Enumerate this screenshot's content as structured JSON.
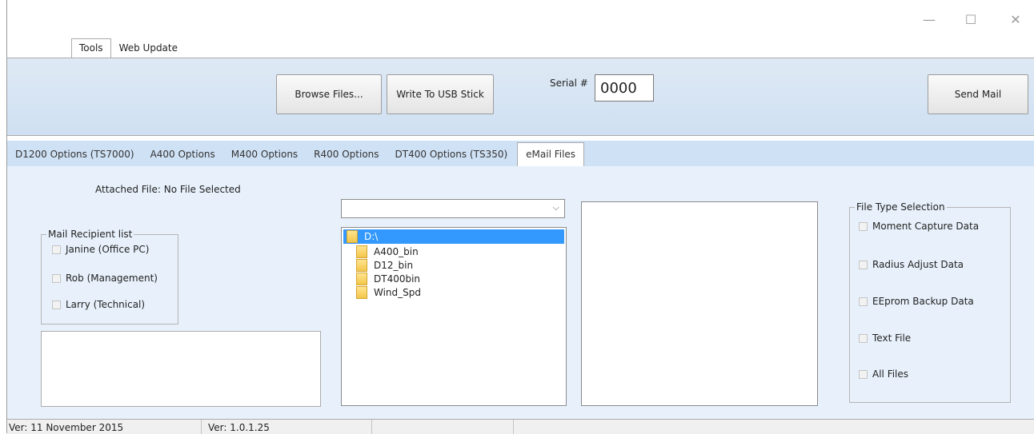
{
  "window_controls": {
    "minimize": "—",
    "maximize": "☐",
    "close": "✕"
  },
  "top_tabs": [
    {
      "label": "Tools",
      "active": true
    },
    {
      "label": "Web Update",
      "active": false
    }
  ],
  "toolbar": {
    "browse_label": "Browse Files...",
    "write_usb_label": "Write To USB Stick",
    "serial_label": "Serial #",
    "serial_value": "0000",
    "send_mail_label": "Send Mail"
  },
  "sub_tabs": [
    {
      "label": "D1200 Options (TS7000)",
      "active": false
    },
    {
      "label": "A400 Options",
      "active": false
    },
    {
      "label": "M400 Options",
      "active": false
    },
    {
      "label": "R400 Options",
      "active": false
    },
    {
      "label": "DT400 Options (TS350)",
      "active": false
    },
    {
      "label": "eMail Files",
      "active": true
    }
  ],
  "email": {
    "attached_file": "Attached File: No File Selected",
    "recipients": {
      "legend": "Mail Recipient list",
      "items": [
        {
          "label": "Janine (Office PC)",
          "checked": false
        },
        {
          "label": "Rob (Management)",
          "checked": false
        },
        {
          "label": "Larry (Technical)",
          "checked": false
        }
      ]
    },
    "drive_combo_value": "",
    "directories": [
      {
        "label": "D:\\",
        "selected": true
      },
      {
        "label": "A400_bin",
        "selected": false
      },
      {
        "label": "D12_bin",
        "selected": false
      },
      {
        "label": "DT400bin",
        "selected": false
      },
      {
        "label": "Wind_Spd",
        "selected": false
      }
    ],
    "file_types": {
      "legend": "File Type Selection",
      "items": [
        {
          "label": "Moment Capture Data",
          "checked": false
        },
        {
          "label": "Radius Adjust Data",
          "checked": false
        },
        {
          "label": "EEprom Backup Data",
          "checked": false
        },
        {
          "label": "Text File",
          "checked": false
        },
        {
          "label": "All Files",
          "checked": false
        }
      ]
    }
  },
  "status_bar": {
    "date_version": "Ver: 11 November 2015",
    "build_version": "Ver: 1.0.1.25"
  }
}
